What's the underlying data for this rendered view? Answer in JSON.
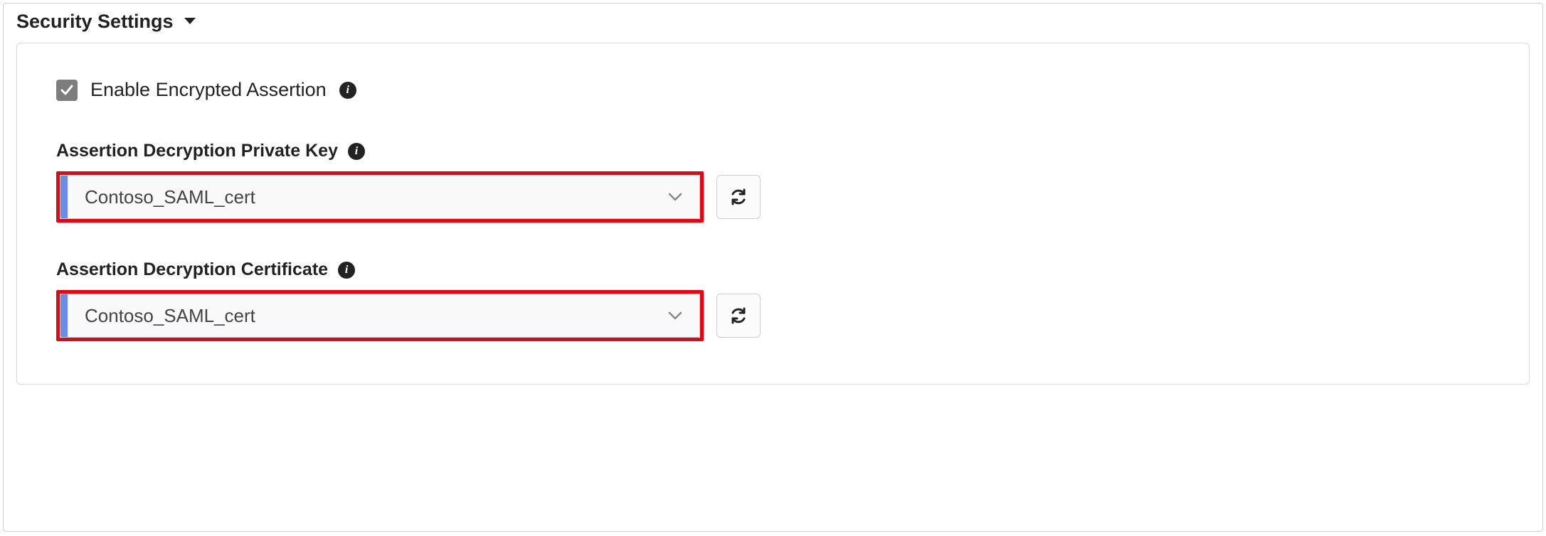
{
  "section": {
    "title": "Security Settings"
  },
  "enable_encrypted": {
    "label": "Enable Encrypted Assertion",
    "checked": true
  },
  "fields": {
    "private_key": {
      "label": "Assertion Decryption Private Key",
      "value": "Contoso_SAML_cert"
    },
    "certificate": {
      "label": "Assertion Decryption Certificate",
      "value": "Contoso_SAML_cert"
    }
  }
}
